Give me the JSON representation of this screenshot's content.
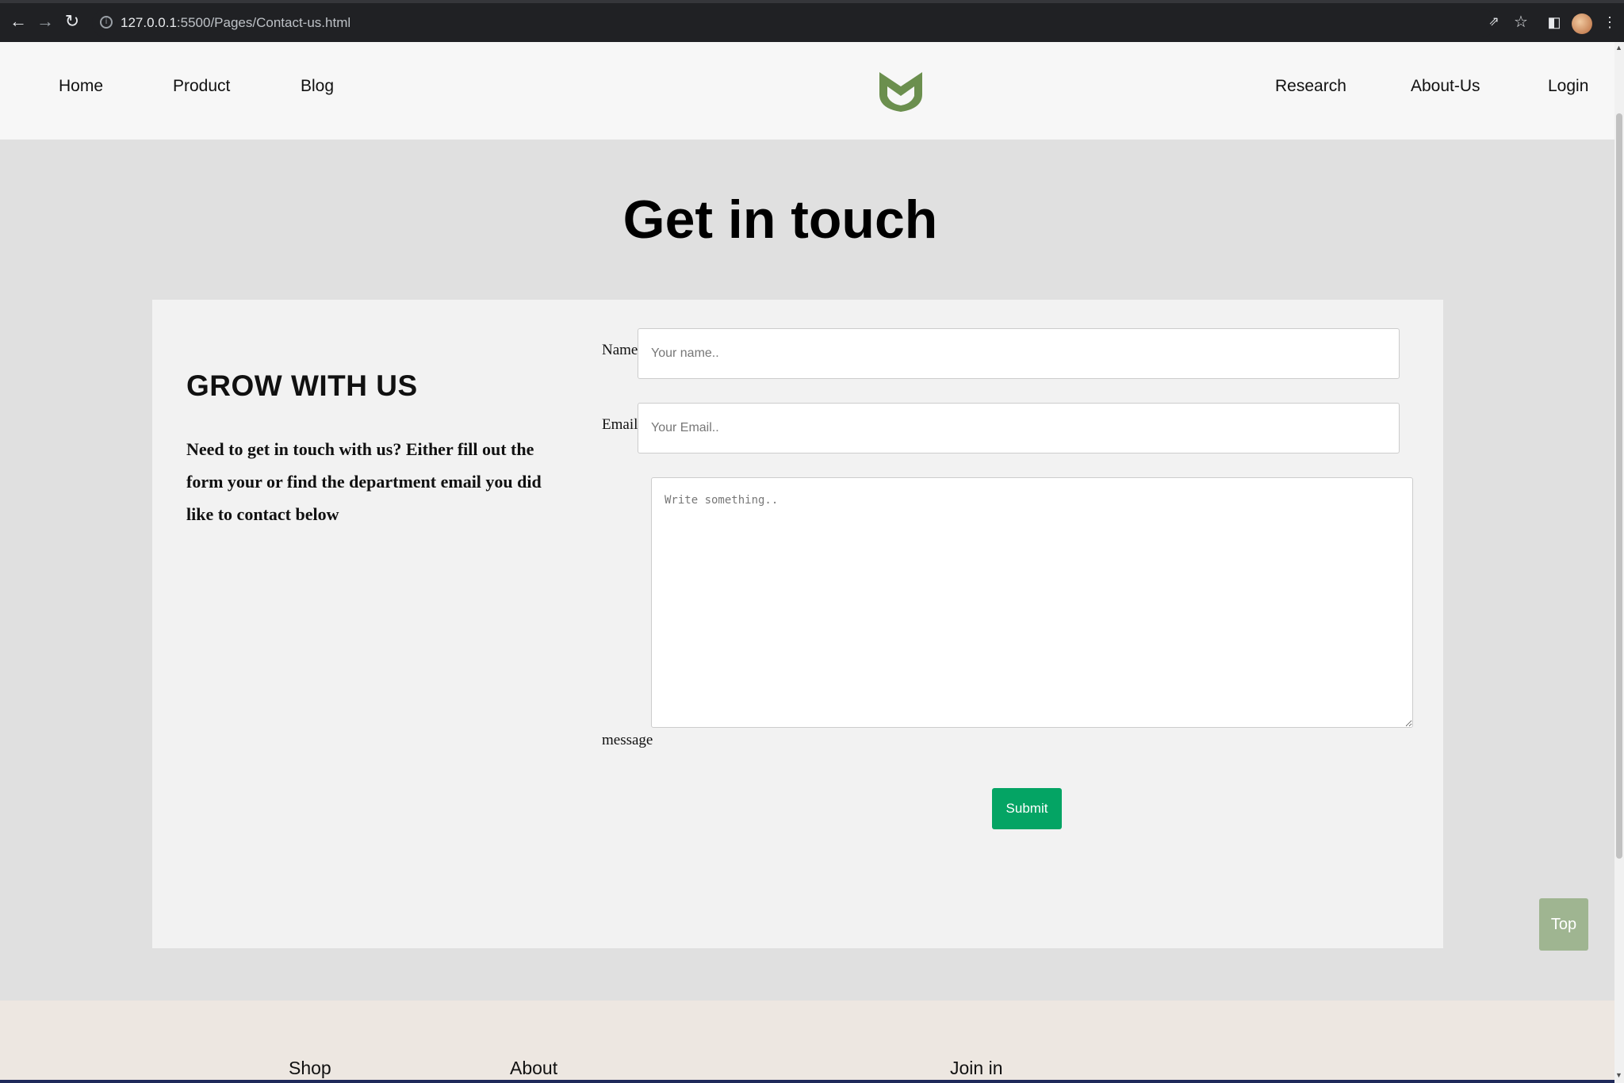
{
  "browser": {
    "url_host": "127.0.0.1",
    "url_rest": ":5500/Pages/Contact-us.html",
    "icons": [
      "back-arrow-icon",
      "forward-arrow-icon",
      "reload-icon",
      "info-icon",
      "share-icon",
      "star-icon",
      "side-panel-icon",
      "menu-icon"
    ]
  },
  "nav": {
    "left": [
      "Home",
      "Product",
      "Blog"
    ],
    "right": [
      "Research",
      "About-Us",
      "Login"
    ],
    "logo_color": "#6b8f4e"
  },
  "page_title": "Get in touch",
  "intro": {
    "title": "GROW WITH US",
    "text": "Need to get in touch with us? Either fill out the form your or find the department email you did like to contact below"
  },
  "form": {
    "name_label": "Name",
    "name_placeholder": "Your name..",
    "email_label": "Email",
    "email_placeholder": "Your Email..",
    "message_label": "message",
    "message_placeholder": "Write something..",
    "submit_label": "Submit",
    "submit_color": "#04a464"
  },
  "top_button": "Top",
  "footer": {
    "columns": [
      "Shop",
      "About",
      "Join in"
    ]
  }
}
